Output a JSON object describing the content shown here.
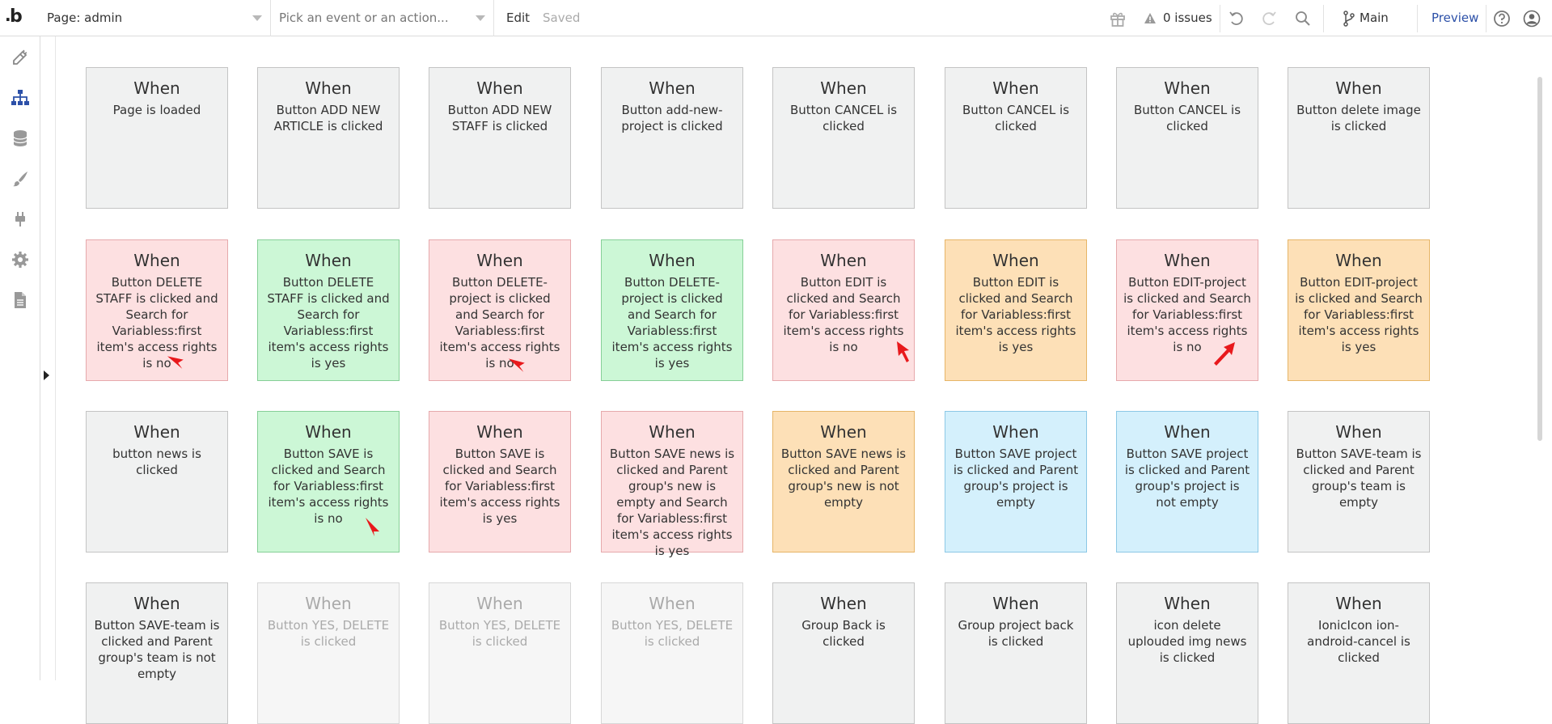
{
  "topbar": {
    "logo": "b",
    "page_select": "Page: admin",
    "event_select_placeholder": "Pick an event or an action...",
    "edit_label": "Edit",
    "saved_label": "Saved",
    "issues_label": "0 issues",
    "branch_label": "Main",
    "preview_label": "Preview"
  },
  "colors": {
    "gray": "#f0f1f1",
    "pink": "#fde0e1",
    "green": "#ccf7d6",
    "orange": "#fde0b7",
    "blue": "#d4f0fc",
    "accent": "#2c50a8",
    "arrow": "#e8191c"
  },
  "leftnav": [
    "design-icon",
    "workflow-icon",
    "data-icon",
    "styles-icon",
    "plugins-icon",
    "settings-icon",
    "logs-icon"
  ],
  "cards": [
    {
      "when": "When",
      "desc": "Page is loaded",
      "color": "gray"
    },
    {
      "when": "When",
      "desc": "Button ADD NEW ARTICLE is clicked",
      "color": "gray"
    },
    {
      "when": "When",
      "desc": "Button ADD NEW STAFF is clicked",
      "color": "gray"
    },
    {
      "when": "When",
      "desc": "Button add-new-project is clicked",
      "color": "gray"
    },
    {
      "when": "When",
      "desc": "Button CANCEL is clicked",
      "color": "gray"
    },
    {
      "when": "When",
      "desc": "Button CANCEL is clicked",
      "color": "gray"
    },
    {
      "when": "When",
      "desc": "Button CANCEL is clicked",
      "color": "gray"
    },
    {
      "when": "When",
      "desc": "Button delete image is clicked",
      "color": "gray"
    },
    {
      "when": "When",
      "desc": "Button DELETE STAFF is clicked and Search for Variabless:first item's access rights is no",
      "color": "pink"
    },
    {
      "when": "When",
      "desc": "Button DELETE STAFF is clicked and Search for Variabless:first item's access rights is yes",
      "color": "green"
    },
    {
      "when": "When",
      "desc": "Button DELETE-project is clicked and Search for Variabless:first item's access rights is no",
      "color": "pink"
    },
    {
      "when": "When",
      "desc": "Button DELETE-project is clicked and Search for Variabless:first item's access rights is yes",
      "color": "green"
    },
    {
      "when": "When",
      "desc": "Button EDIT is clicked and Search for Variabless:first item's access rights is no",
      "color": "pink"
    },
    {
      "when": "When",
      "desc": "Button EDIT is clicked and Search for Variabless:first item's access rights is yes",
      "color": "orange"
    },
    {
      "when": "When",
      "desc": "Button EDIT-project is clicked and Search for Variabless:first item's access rights is no",
      "color": "pink"
    },
    {
      "when": "When",
      "desc": "Button EDIT-project is clicked and Search for Variabless:first item's access rights is yes",
      "color": "orange"
    },
    {
      "when": "When",
      "desc": "button news is clicked",
      "color": "gray"
    },
    {
      "when": "When",
      "desc": "Button SAVE is clicked and Search for Variabless:first item's access rights is no",
      "color": "green"
    },
    {
      "when": "When",
      "desc": "Button SAVE is clicked and Search for Variabless:first item's access rights is yes",
      "color": "pink"
    },
    {
      "when": "When",
      "desc": "Button SAVE news is clicked and Parent group's new is empty and Search for Variabless:first item's access rights is yes",
      "color": "pink"
    },
    {
      "when": "When",
      "desc": "Button SAVE news is clicked and Parent group's new is not empty",
      "color": "orange"
    },
    {
      "when": "When",
      "desc": "Button SAVE project is clicked and Parent group's project is empty",
      "color": "blue"
    },
    {
      "when": "When",
      "desc": "Button SAVE project is clicked and Parent group's project is not empty",
      "color": "blue"
    },
    {
      "when": "When",
      "desc": "Button SAVE-team is clicked and Parent group's team is empty",
      "color": "gray"
    },
    {
      "when": "When",
      "desc": "Button SAVE-team is clicked and Parent group's team is not empty",
      "color": "gray"
    },
    {
      "when": "When",
      "desc": "Button YES, DELETE is clicked",
      "color": "faded"
    },
    {
      "when": "When",
      "desc": "Button YES, DELETE is clicked",
      "color": "faded"
    },
    {
      "when": "When",
      "desc": "Button YES, DELETE is clicked",
      "color": "faded"
    },
    {
      "when": "When",
      "desc": "Group Back is clicked",
      "color": "gray"
    },
    {
      "when": "When",
      "desc": "Group project back is clicked",
      "color": "gray"
    },
    {
      "when": "When",
      "desc": "icon delete uplouded img news is clicked",
      "color": "gray"
    },
    {
      "when": "When",
      "desc": "IonicIcon ion-android-cancel is clicked",
      "color": "gray"
    }
  ]
}
